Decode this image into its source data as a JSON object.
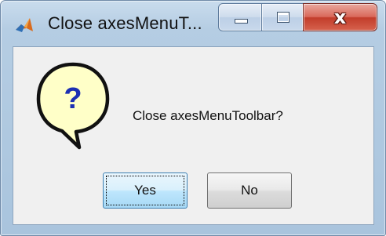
{
  "window": {
    "title": "Close axesMenuT...",
    "controls": {
      "minimize_icon": "minimize-icon",
      "maximize_icon": "maximize-icon",
      "close_glyph": "x"
    }
  },
  "dialog": {
    "icon": "question-icon",
    "icon_glyph": "?",
    "message": "Close axesMenuToolbar?",
    "buttons": {
      "yes_label": "Yes",
      "no_label": "No",
      "default": "Yes"
    }
  },
  "colors": {
    "close_button": "#c23d2b",
    "title_bar": "#b5cde3",
    "bubble_fill": "#ffffc8",
    "question_mark": "#1c2fb3",
    "focused_button": "#bee6fd"
  }
}
